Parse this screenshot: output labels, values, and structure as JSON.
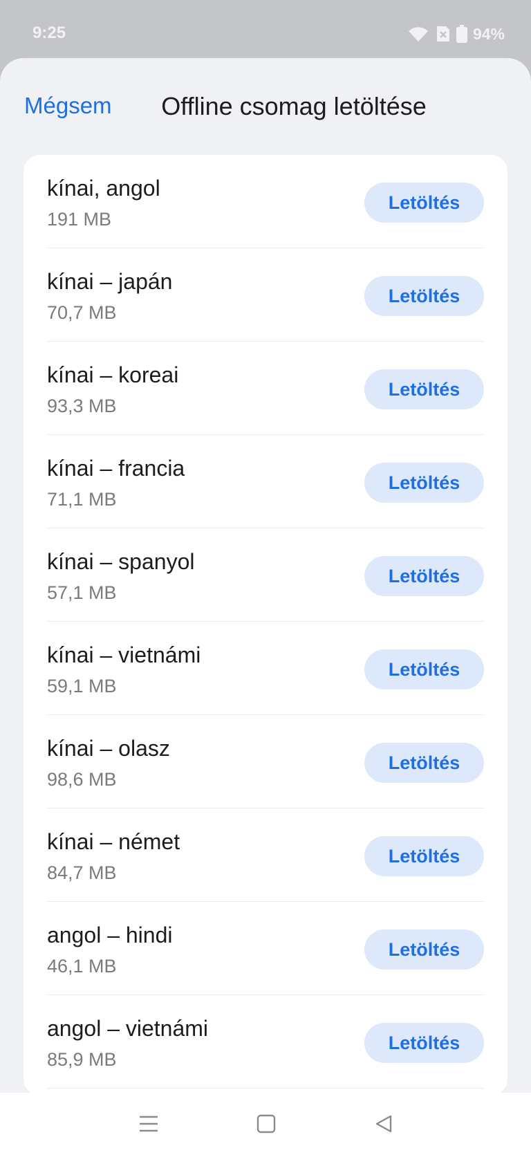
{
  "status": {
    "time": "9:25",
    "battery": "94%",
    "icons": [
      "wifi-icon",
      "no-sim-icon",
      "battery-icon"
    ]
  },
  "header": {
    "cancel_label": "Mégsem",
    "title": "Offline csomag letöltése"
  },
  "packages": [
    {
      "name": "kínai, angol",
      "size": "191 MB",
      "action": "Letöltés"
    },
    {
      "name": "kínai – japán",
      "size": "70,7 MB",
      "action": "Letöltés"
    },
    {
      "name": "kínai – koreai",
      "size": "93,3 MB",
      "action": "Letöltés"
    },
    {
      "name": "kínai – francia",
      "size": "71,1 MB",
      "action": "Letöltés"
    },
    {
      "name": "kínai – spanyol",
      "size": "57,1 MB",
      "action": "Letöltés"
    },
    {
      "name": "kínai – vietnámi",
      "size": "59,1 MB",
      "action": "Letöltés"
    },
    {
      "name": "kínai – olasz",
      "size": "98,6 MB",
      "action": "Letöltés"
    },
    {
      "name": "kínai – német",
      "size": "84,7 MB",
      "action": "Letöltés"
    },
    {
      "name": "angol – hindi",
      "size": "46,1 MB",
      "action": "Letöltés"
    },
    {
      "name": "angol – vietnámi",
      "size": "85,9 MB",
      "action": "Letöltés"
    }
  ],
  "navbar": {
    "icons": [
      "menu-icon",
      "home-icon",
      "back-icon"
    ]
  },
  "colors": {
    "accent": "#1f6fe0",
    "button_bg": "#dde9fb",
    "sheet_bg": "#f0f1f5"
  }
}
